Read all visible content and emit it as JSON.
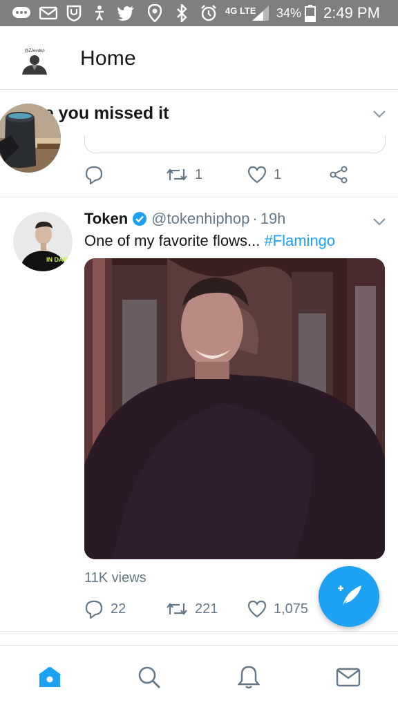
{
  "status_bar": {
    "battery": "34%",
    "time": "2:49 PM",
    "network": "4G LTE",
    "icons": [
      "chat-bubble-icon",
      "mail-icon",
      "shield-icon",
      "accessibility-icon",
      "twitter-bird-icon",
      "location-pin-icon",
      "bluetooth-icon",
      "alarm-icon",
      "signal-icon",
      "battery-icon"
    ]
  },
  "header": {
    "title": "Home",
    "avatar_label": "@ZJeeden"
  },
  "missed": {
    "title": "ase you missed it",
    "actions": {
      "reply_count": "",
      "retweet_count": "1",
      "like_count": "1"
    }
  },
  "tweet": {
    "name": "Token",
    "handle": "@tokenhiphop",
    "separator": "·",
    "time": "19h",
    "text": "One of my favorite flows... ",
    "hashtag": "#Flamingo",
    "views": "11K views",
    "reply_count": "22",
    "retweet_count": "221",
    "like_count": "1,075",
    "avatar_shirt_text": "IN DAM"
  },
  "colors": {
    "accent": "#1da1f2",
    "muted": "#657786",
    "status_bar": "#7f7f7f"
  },
  "bottom_nav": {
    "items": [
      "home-icon",
      "search-icon",
      "notifications-icon",
      "messages-icon"
    ]
  }
}
